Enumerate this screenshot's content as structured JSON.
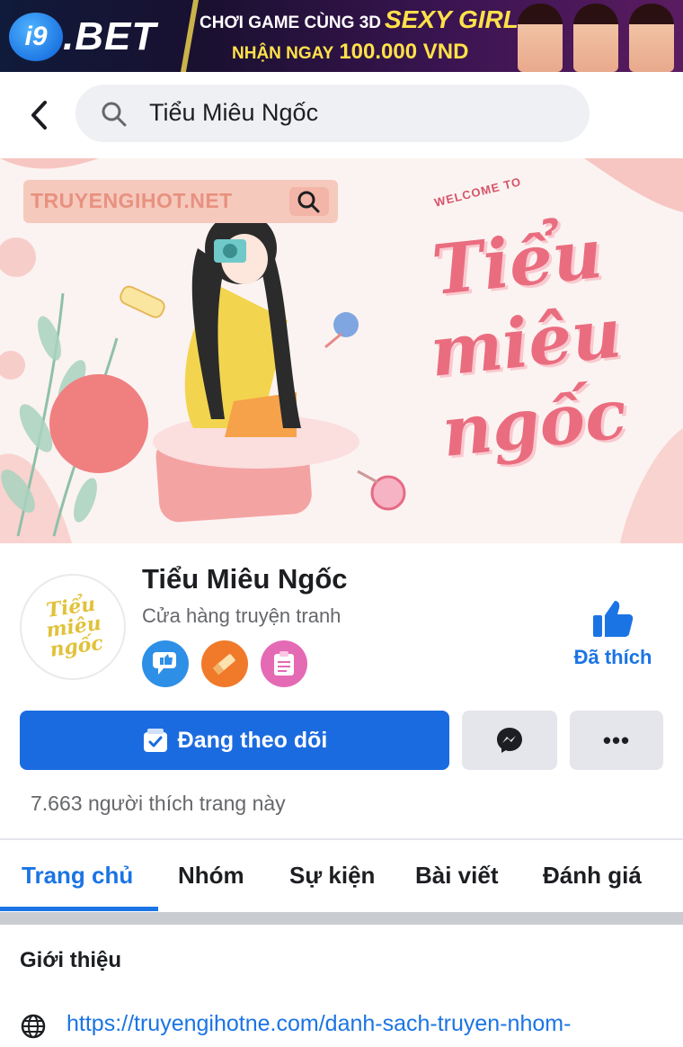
{
  "ad": {
    "brand_prefix": "i9",
    "brand_suffix": ".BET",
    "line1": "CHƠI GAME CÙNG 3D",
    "line1_highlight": "SEXY GIRL",
    "line2": "NHẬN NGAY",
    "line2_highlight": "100.000 VND"
  },
  "search": {
    "query": "Tiểu Miêu Ngốc"
  },
  "cover": {
    "site_label": "TRUYENGIHOT.NET",
    "welcome": "WELCOME TO",
    "title_art": "Tiểu miêu ngốc"
  },
  "profile": {
    "name": "Tiểu Miêu Ngốc",
    "category": "Cửa hàng truyện tranh",
    "avatar_text": "Tiểu miêu ngốc",
    "liked_label": "Đã thích",
    "follow_label": "Đang theo dõi",
    "more_label": "•••",
    "likes_text": "7.663 người thích trang này"
  },
  "tabs": [
    {
      "label": "Trang chủ",
      "active": true
    },
    {
      "label": "Nhóm"
    },
    {
      "label": "Sự kiện"
    },
    {
      "label": "Bài viết"
    },
    {
      "label": "Đánh giá"
    }
  ],
  "intro": {
    "title": "Giới thiệu",
    "link": "https://truyengihotne.com/danh-sach-truyen-nhom-"
  },
  "colors": {
    "primary": "#1b74e4",
    "follow_button": "#1b6be0",
    "cover_pink": "#ea6d7f"
  }
}
